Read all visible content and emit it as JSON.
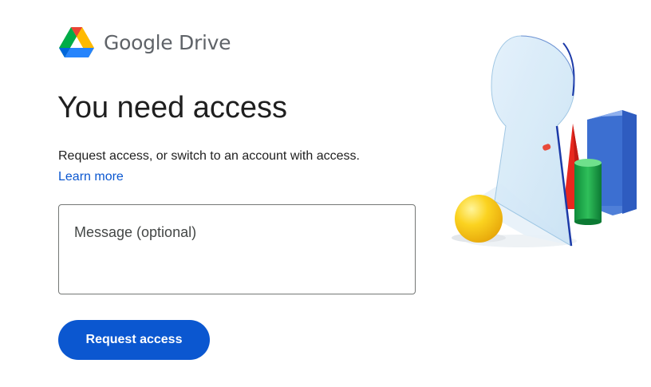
{
  "header": {
    "brand": "Google",
    "product": "Drive",
    "logo_icon": "google-drive-logo-icon"
  },
  "main": {
    "title": "You need access",
    "description": "Request access, or switch to an account with access.",
    "learn_more_label": "Learn more",
    "message_placeholder": "Message (optional)",
    "message_value": "",
    "request_button_label": "Request access"
  },
  "illustration": {
    "icon": "keyhole-illustration"
  },
  "colors": {
    "accent": "#0b57d0",
    "text": "#1f1f1f",
    "logo_text": "#5f6368"
  }
}
